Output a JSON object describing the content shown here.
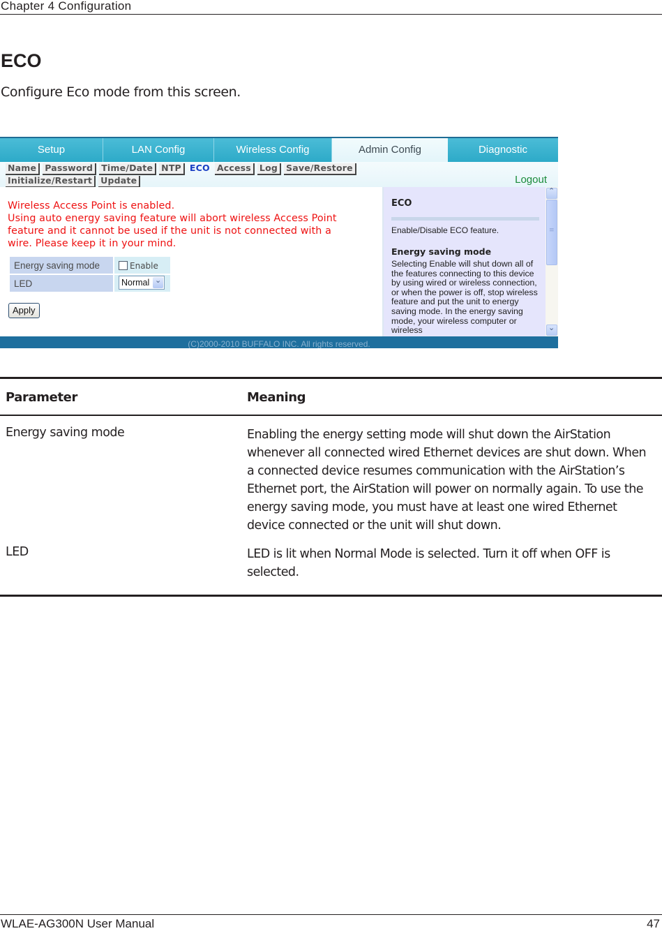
{
  "chapter_header": "Chapter 4  Configuration",
  "section": {
    "title": "ECO",
    "intro": "Configure Eco mode from this screen."
  },
  "router_ui": {
    "top_tabs": [
      {
        "label": "Setup",
        "active": false
      },
      {
        "label": "LAN Config",
        "active": false
      },
      {
        "label": "Wireless Config",
        "active": false
      },
      {
        "label": "Admin Config",
        "active": true
      },
      {
        "label": "Diagnostic",
        "active": false
      }
    ],
    "sub_nav_row1": [
      {
        "label": "Name",
        "active": false
      },
      {
        "label": "Password",
        "active": false
      },
      {
        "label": "Time/Date",
        "active": false
      },
      {
        "label": "NTP",
        "active": false
      },
      {
        "label": "ECO",
        "active": true
      },
      {
        "label": "Access",
        "active": false
      },
      {
        "label": "Log",
        "active": false
      },
      {
        "label": "Save/Restore",
        "active": false
      }
    ],
    "sub_nav_row2": [
      {
        "label": "Initialize/Restart",
        "active": false
      },
      {
        "label": "Update",
        "active": false
      }
    ],
    "logout_label": "Logout",
    "warning_lines": [
      "Wireless Access Point is enabled.",
      "Using auto energy saving feature will abort wireless Access Point",
      "feature and it cannot be used if the unit is not connected with a",
      "wire. Please keep it in your mind."
    ],
    "form": {
      "energy_saving_label": "Energy saving mode",
      "energy_saving_checkbox_label": "Enable",
      "energy_saving_checked": false,
      "led_label": "LED",
      "led_value": "Normal",
      "apply_label": "Apply"
    },
    "help": {
      "title": "ECO",
      "description": "Enable/Disable ECO feature.",
      "subtitle": "Energy saving mode",
      "body": "Selecting Enable will shut down all of the features connecting to this device by using wired or wireless connection, or when the power is off, stop wireless feature and put the unit to energy saving mode. In the energy saving mode, your wireless computer or wireless"
    },
    "copyright": "(C)2000-2010 BUFFALO INC. All rights reserved."
  },
  "param_table": {
    "headers": [
      "Parameter",
      "Meaning"
    ],
    "rows": [
      {
        "parameter": "Energy saving mode",
        "meaning": "Enabling the energy setting mode will shut down the AirStation whenever all connected wired Ethernet devices are shut down. When a connected device resumes communication with the AirStation’s Ethernet port, the AirStation will power on normally again.  To use the energy saving mode, you must have at least one wired Ethernet device connected or the unit will shut down."
      },
      {
        "parameter": "LED",
        "meaning": "LED is lit when Normal Mode is selected. Turn it off when OFF is selected."
      }
    ]
  },
  "page_footer": {
    "manual_title": "WLAE-AG300N User Manual",
    "page_number": "47"
  },
  "colors": {
    "tab_bar": "#3ab3cf",
    "footer_bar": "#1e6f9e",
    "warning_text": "#ee1111",
    "active_subnav": "#1a3fc4",
    "logout": "#1a8b3a",
    "help_bg": "#e5e5fc"
  }
}
